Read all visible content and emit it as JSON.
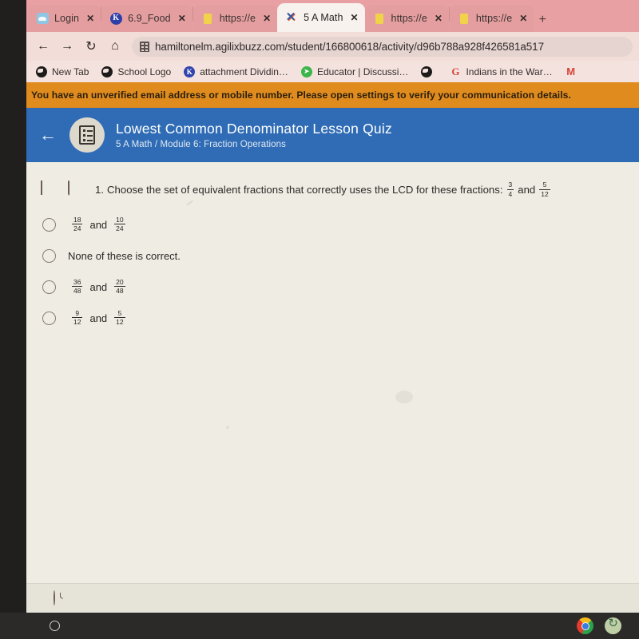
{
  "browser": {
    "tabs": [
      {
        "favicon": "cloud-icon",
        "label": "Login",
        "close": "✕",
        "active": false
      },
      {
        "favicon": "kahoot-k-icon",
        "label": "6.9_Food",
        "close": "✕",
        "active": false
      },
      {
        "favicon": "yellow-doc-icon",
        "label": "https://e",
        "close": "✕",
        "active": false
      },
      {
        "favicon": "buzz-x-icon",
        "label": "5 A Math",
        "close": "✕",
        "active": true
      },
      {
        "favicon": "yellow-doc-icon",
        "label": "https://e",
        "close": "✕",
        "active": false
      },
      {
        "favicon": "yellow-doc-icon",
        "label": "https://e",
        "close": "✕",
        "active": false
      }
    ],
    "new_tab_label": "+",
    "toolbar": {
      "back_label": "←",
      "forward_label": "→",
      "reload_label": "↻",
      "home_label": "⌂",
      "url": "hamiltonelm.agilixbuzz.com/student/166800618/activity/d96b788a928f426581a517"
    },
    "bookmarks": [
      {
        "icon": "globe-icon",
        "label": "New Tab"
      },
      {
        "icon": "globe-icon",
        "label": "School Logo"
      },
      {
        "icon": "kahoot-k-icon",
        "label": "attachment Dividin…"
      },
      {
        "icon": "green-arrow-icon",
        "label": "Educator | Discussi…"
      },
      {
        "icon": "globe-icon",
        "label": ""
      },
      {
        "icon": "google-g-icon",
        "label": "Indians in the War…"
      },
      {
        "icon": "gmail-icon",
        "label": ""
      }
    ]
  },
  "notice": {
    "text": "You have an unverified email address or mobile number. Please open settings to verify your communication details."
  },
  "quiz": {
    "back_label": "←",
    "icon": "quiz-sheet-icon",
    "title": "Lowest Common Denominator Lesson Quiz",
    "subtitle": "5 A Math / Module 6: Fraction Operations",
    "question": {
      "bookmark_icon": "bookmark-icon",
      "note_icon": "note-icon",
      "number": "1.",
      "text_before": "Choose the set of equivalent fractions that correctly uses the LCD for these fractions:",
      "fraction_1": {
        "numerator": "3",
        "denominator": "4"
      },
      "conjunction": "and",
      "fraction_2": {
        "numerator": "5",
        "denominator": "12"
      }
    },
    "options": [
      {
        "type": "fractions",
        "fraction_1": {
          "numerator": "18",
          "denominator": "24"
        },
        "conjunction": "and",
        "fraction_2": {
          "numerator": "10",
          "denominator": "24"
        },
        "selected": false
      },
      {
        "type": "text",
        "label": "None of these is correct.",
        "selected": false
      },
      {
        "type": "fractions",
        "fraction_1": {
          "numerator": "36",
          "denominator": "48"
        },
        "conjunction": "and",
        "fraction_2": {
          "numerator": "20",
          "denominator": "48"
        },
        "selected": false
      },
      {
        "type": "fractions",
        "fraction_1": {
          "numerator": "9",
          "denominator": "12"
        },
        "conjunction": "and",
        "fraction_2": {
          "numerator": "5",
          "denominator": "12"
        },
        "selected": false
      }
    ],
    "footer": {
      "icon": "clock-icon"
    }
  },
  "taskbar": {
    "launcher_icon": "launcher-circle-icon",
    "tray": [
      {
        "icon": "chrome-icon"
      },
      {
        "icon": "refresh-green-icon"
      }
    ]
  },
  "colors": {
    "tabstrip": "#e8a0a2",
    "toolbar": "#f2ddd9",
    "notice": "#e08b1e",
    "quiz_header": "#2f6cb5",
    "quiz_body": "#eeece3",
    "taskbar": "#2b2a28"
  }
}
